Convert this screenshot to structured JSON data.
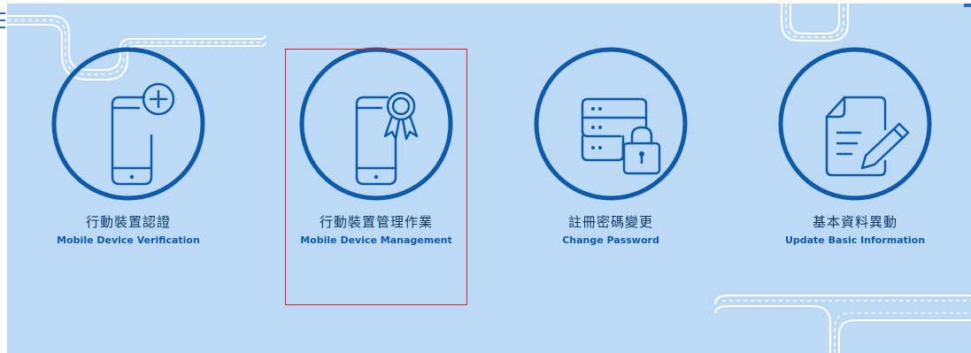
{
  "cards": [
    {
      "title_zh": "行動裝置認證",
      "title_en": "Mobile Device Verification",
      "icon": "phone-plus-icon"
    },
    {
      "title_zh": "行動裝置管理作業",
      "title_en": "Mobile Device Management",
      "icon": "phone-award-icon"
    },
    {
      "title_zh": "註冊密碼變更",
      "title_en": "Change Password",
      "icon": "server-lock-icon"
    },
    {
      "title_zh": "基本資料異動",
      "title_en": "Update Basic Information",
      "icon": "document-edit-icon"
    }
  ],
  "selected_card": "Mobile Device Management",
  "colors": {
    "background": "#bcdaf5",
    "icon_blue": "#0e5aa7",
    "highlight": "#d81f26"
  }
}
